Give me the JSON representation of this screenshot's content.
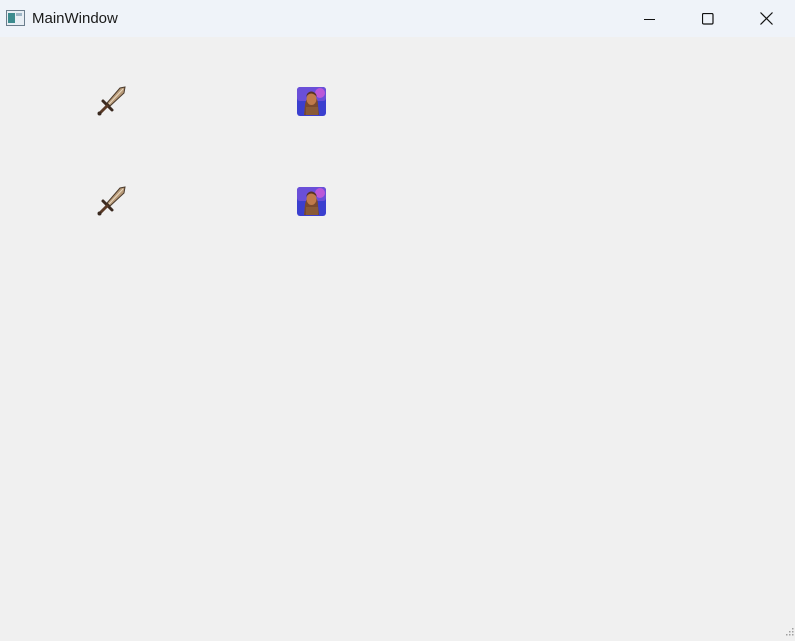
{
  "window": {
    "title": "MainWindow",
    "icon": "app-window-icon",
    "controls": {
      "minimize": "minimize-icon",
      "maximize": "maximize-icon",
      "close": "close-icon"
    }
  },
  "content": {
    "items": [
      {
        "icon": "sword-icon"
      },
      {
        "icon": "warrior-portrait-icon"
      },
      {
        "icon": "sword-icon"
      },
      {
        "icon": "warrior-portrait-icon"
      }
    ]
  },
  "colors": {
    "titlebar_bg": "#eff3f9",
    "client_bg": "#f0f0f0"
  }
}
